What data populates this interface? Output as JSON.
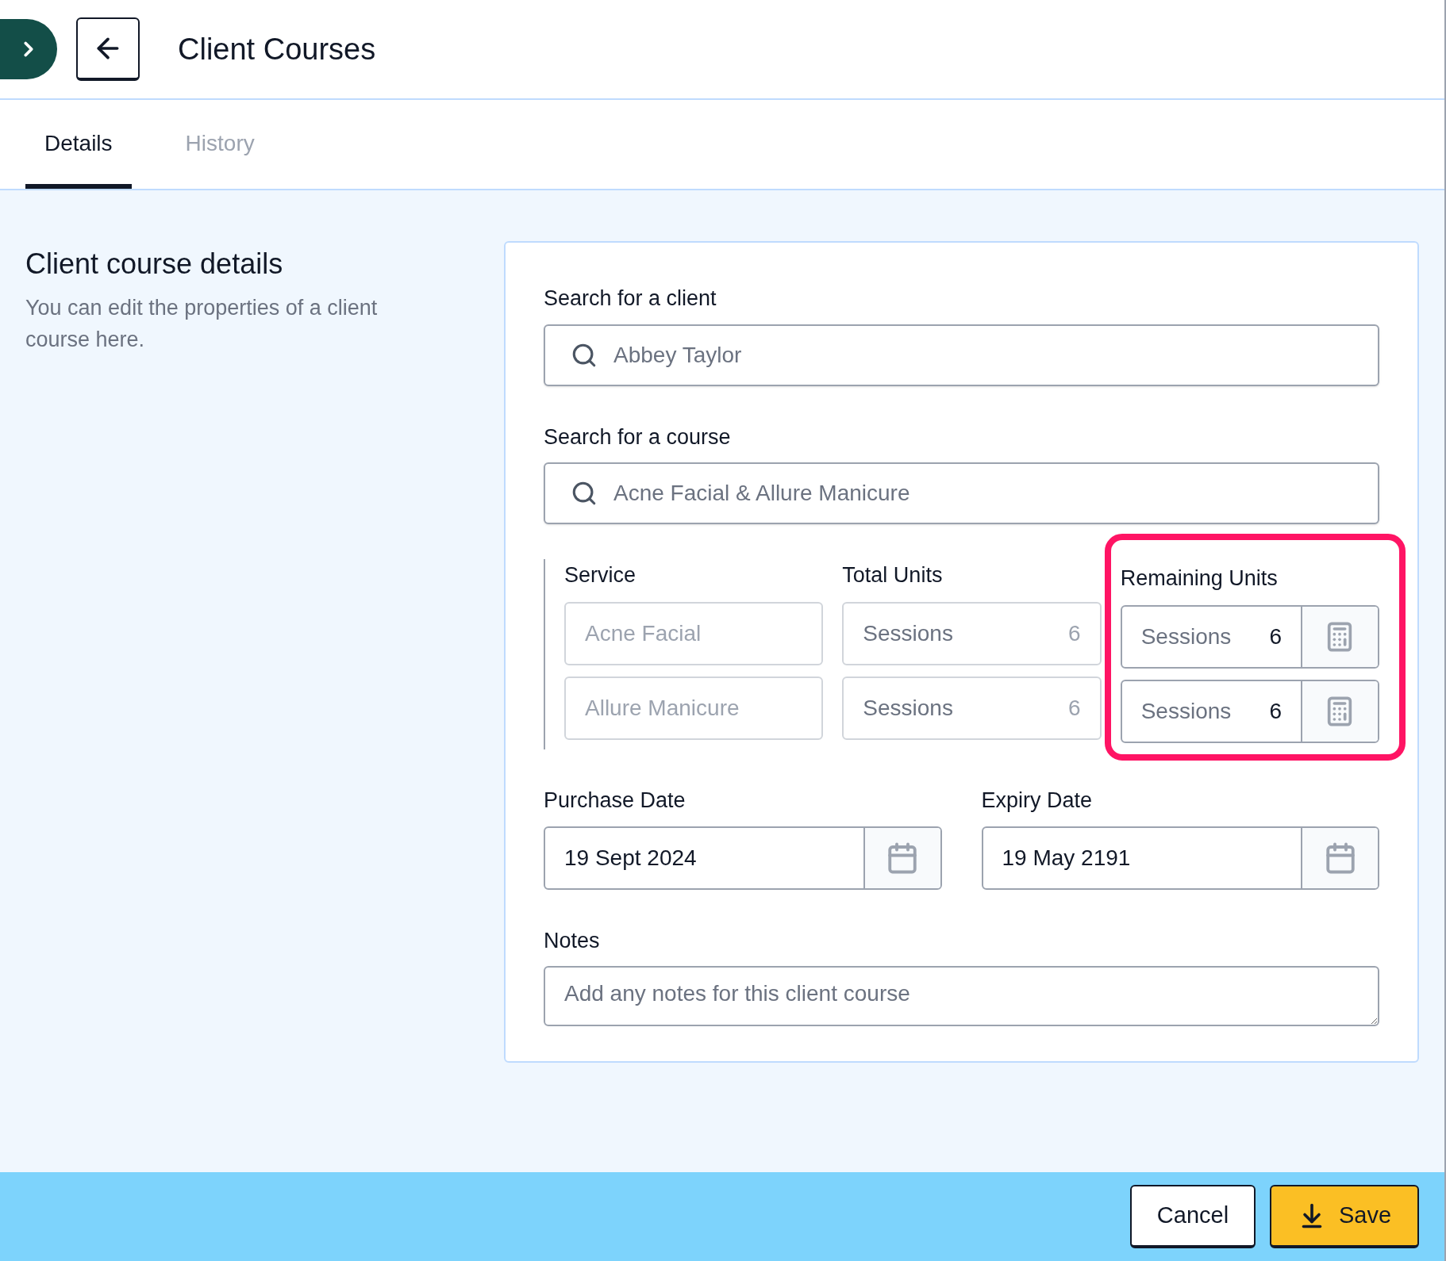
{
  "header": {
    "title": "Client Courses",
    "tabs": [
      {
        "label": "Details",
        "selected": true
      },
      {
        "label": "History",
        "selected": false
      }
    ]
  },
  "section": {
    "title": "Client course details",
    "description": "You can edit the properties of a client course here."
  },
  "client_search": {
    "label": "Search for a client",
    "value": "Abbey Taylor"
  },
  "course_search": {
    "label": "Search for a course",
    "value": "Acne Facial & Allure Manicure"
  },
  "units": {
    "columns": [
      "Service",
      "Total Units",
      "Remaining Units"
    ],
    "remaining_highlighted": true,
    "rows": [
      {
        "service": "Acne Facial",
        "total_unit": "Sessions",
        "total_value": "6",
        "remaining_unit": "Sessions",
        "remaining_value": "6",
        "disabled": true
      },
      {
        "service": "Allure Manicure",
        "total_unit": "Sessions",
        "total_value": "6",
        "remaining_unit": "Sessions",
        "remaining_value": "6",
        "disabled": true
      }
    ]
  },
  "purchase_date": {
    "label": "Purchase Date",
    "value": "19 Sept 2024"
  },
  "expiry_date": {
    "label": "Expiry Date",
    "value": "19 May 2191"
  },
  "notes": {
    "label": "Notes",
    "placeholder": "Add any notes for this client course"
  },
  "footer": {
    "buttons": [
      {
        "kind": "cancel",
        "label": "Cancel"
      },
      {
        "kind": "save",
        "label": "Save"
      }
    ]
  }
}
